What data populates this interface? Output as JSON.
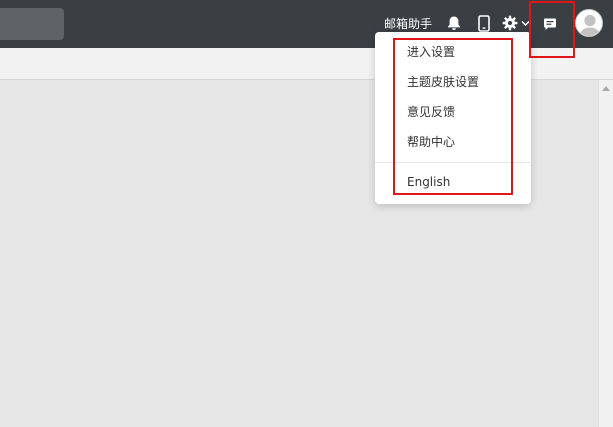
{
  "topbar": {
    "mail_assistant_label": "邮箱助手",
    "icons": [
      "bell-icon",
      "phone-icon",
      "gear-icon",
      "chevron-down-icon",
      "message-icon"
    ]
  },
  "dropdown": {
    "items": [
      "进入设置",
      "主题皮肤设置",
      "意见反馈",
      "帮助中心"
    ],
    "language_item": "English"
  },
  "colors": {
    "topbar": "#3a3f44",
    "highlight": "#e0151a",
    "content_bg": "#e6e6e6"
  }
}
